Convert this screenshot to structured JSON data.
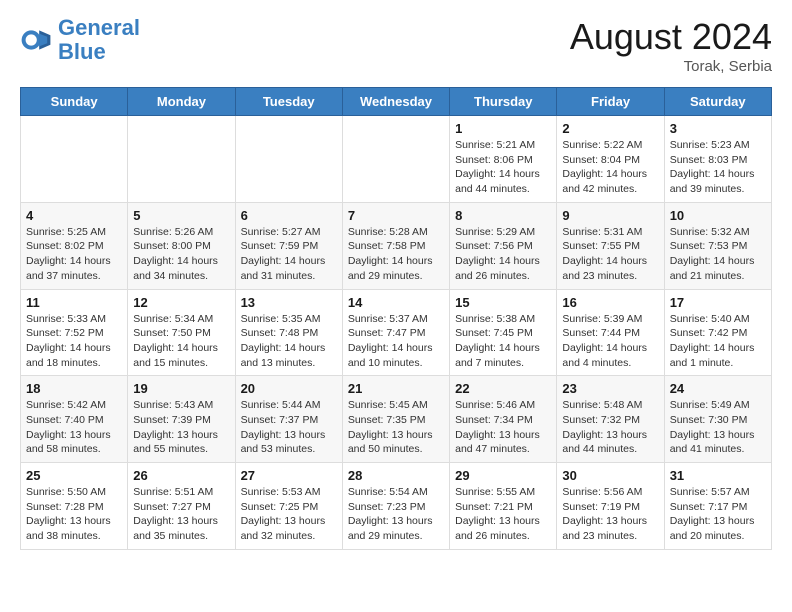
{
  "header": {
    "logo_line1": "General",
    "logo_line2": "Blue",
    "month_year": "August 2024",
    "location": "Torak, Serbia"
  },
  "weekdays": [
    "Sunday",
    "Monday",
    "Tuesday",
    "Wednesday",
    "Thursday",
    "Friday",
    "Saturday"
  ],
  "weeks": [
    [
      {
        "day": "",
        "info": ""
      },
      {
        "day": "",
        "info": ""
      },
      {
        "day": "",
        "info": ""
      },
      {
        "day": "",
        "info": ""
      },
      {
        "day": "1",
        "info": "Sunrise: 5:21 AM\nSunset: 8:06 PM\nDaylight: 14 hours and 44 minutes."
      },
      {
        "day": "2",
        "info": "Sunrise: 5:22 AM\nSunset: 8:04 PM\nDaylight: 14 hours and 42 minutes."
      },
      {
        "day": "3",
        "info": "Sunrise: 5:23 AM\nSunset: 8:03 PM\nDaylight: 14 hours and 39 minutes."
      }
    ],
    [
      {
        "day": "4",
        "info": "Sunrise: 5:25 AM\nSunset: 8:02 PM\nDaylight: 14 hours and 37 minutes."
      },
      {
        "day": "5",
        "info": "Sunrise: 5:26 AM\nSunset: 8:00 PM\nDaylight: 14 hours and 34 minutes."
      },
      {
        "day": "6",
        "info": "Sunrise: 5:27 AM\nSunset: 7:59 PM\nDaylight: 14 hours and 31 minutes."
      },
      {
        "day": "7",
        "info": "Sunrise: 5:28 AM\nSunset: 7:58 PM\nDaylight: 14 hours and 29 minutes."
      },
      {
        "day": "8",
        "info": "Sunrise: 5:29 AM\nSunset: 7:56 PM\nDaylight: 14 hours and 26 minutes."
      },
      {
        "day": "9",
        "info": "Sunrise: 5:31 AM\nSunset: 7:55 PM\nDaylight: 14 hours and 23 minutes."
      },
      {
        "day": "10",
        "info": "Sunrise: 5:32 AM\nSunset: 7:53 PM\nDaylight: 14 hours and 21 minutes."
      }
    ],
    [
      {
        "day": "11",
        "info": "Sunrise: 5:33 AM\nSunset: 7:52 PM\nDaylight: 14 hours and 18 minutes."
      },
      {
        "day": "12",
        "info": "Sunrise: 5:34 AM\nSunset: 7:50 PM\nDaylight: 14 hours and 15 minutes."
      },
      {
        "day": "13",
        "info": "Sunrise: 5:35 AM\nSunset: 7:48 PM\nDaylight: 14 hours and 13 minutes."
      },
      {
        "day": "14",
        "info": "Sunrise: 5:37 AM\nSunset: 7:47 PM\nDaylight: 14 hours and 10 minutes."
      },
      {
        "day": "15",
        "info": "Sunrise: 5:38 AM\nSunset: 7:45 PM\nDaylight: 14 hours and 7 minutes."
      },
      {
        "day": "16",
        "info": "Sunrise: 5:39 AM\nSunset: 7:44 PM\nDaylight: 14 hours and 4 minutes."
      },
      {
        "day": "17",
        "info": "Sunrise: 5:40 AM\nSunset: 7:42 PM\nDaylight: 14 hours and 1 minute."
      }
    ],
    [
      {
        "day": "18",
        "info": "Sunrise: 5:42 AM\nSunset: 7:40 PM\nDaylight: 13 hours and 58 minutes."
      },
      {
        "day": "19",
        "info": "Sunrise: 5:43 AM\nSunset: 7:39 PM\nDaylight: 13 hours and 55 minutes."
      },
      {
        "day": "20",
        "info": "Sunrise: 5:44 AM\nSunset: 7:37 PM\nDaylight: 13 hours and 53 minutes."
      },
      {
        "day": "21",
        "info": "Sunrise: 5:45 AM\nSunset: 7:35 PM\nDaylight: 13 hours and 50 minutes."
      },
      {
        "day": "22",
        "info": "Sunrise: 5:46 AM\nSunset: 7:34 PM\nDaylight: 13 hours and 47 minutes."
      },
      {
        "day": "23",
        "info": "Sunrise: 5:48 AM\nSunset: 7:32 PM\nDaylight: 13 hours and 44 minutes."
      },
      {
        "day": "24",
        "info": "Sunrise: 5:49 AM\nSunset: 7:30 PM\nDaylight: 13 hours and 41 minutes."
      }
    ],
    [
      {
        "day": "25",
        "info": "Sunrise: 5:50 AM\nSunset: 7:28 PM\nDaylight: 13 hours and 38 minutes."
      },
      {
        "day": "26",
        "info": "Sunrise: 5:51 AM\nSunset: 7:27 PM\nDaylight: 13 hours and 35 minutes."
      },
      {
        "day": "27",
        "info": "Sunrise: 5:53 AM\nSunset: 7:25 PM\nDaylight: 13 hours and 32 minutes."
      },
      {
        "day": "28",
        "info": "Sunrise: 5:54 AM\nSunset: 7:23 PM\nDaylight: 13 hours and 29 minutes."
      },
      {
        "day": "29",
        "info": "Sunrise: 5:55 AM\nSunset: 7:21 PM\nDaylight: 13 hours and 26 minutes."
      },
      {
        "day": "30",
        "info": "Sunrise: 5:56 AM\nSunset: 7:19 PM\nDaylight: 13 hours and 23 minutes."
      },
      {
        "day": "31",
        "info": "Sunrise: 5:57 AM\nSunset: 7:17 PM\nDaylight: 13 hours and 20 minutes."
      }
    ]
  ]
}
